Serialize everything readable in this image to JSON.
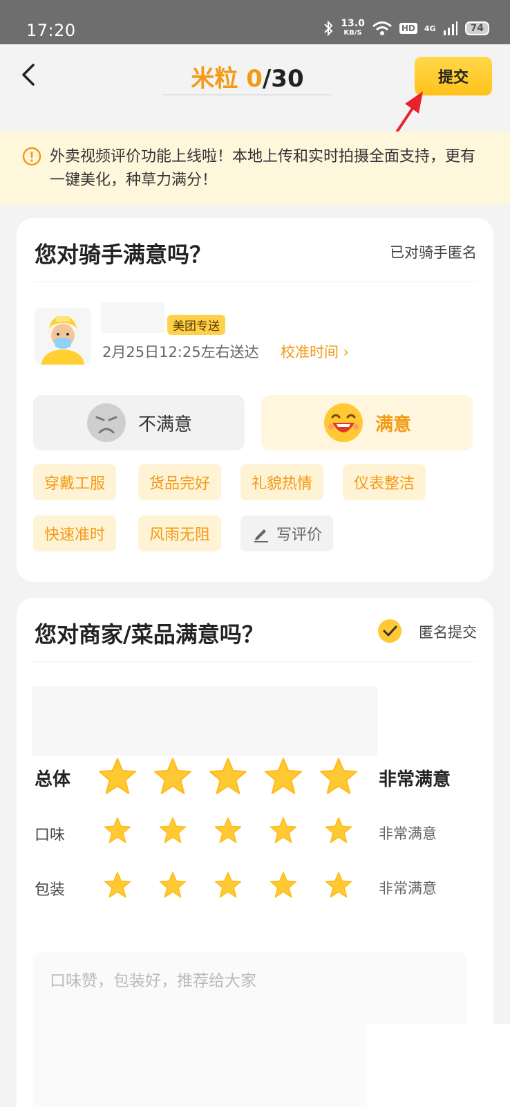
{
  "status_bar": {
    "time": "17:20",
    "net_speed": "13.0",
    "net_unit": "KB/S",
    "hd_badge": "HD",
    "signal_label": "4G",
    "battery": "74"
  },
  "header": {
    "title_label": "米粒",
    "title_current": "0",
    "title_total": "/30",
    "submit_label": "提交",
    "accent_color": "#f39a15"
  },
  "notice": {
    "text": "外卖视频评价功能上线啦！本地上传和实时拍摄全面支持，更有一键美化，种草力满分！"
  },
  "rider_card": {
    "title": "您对骑手满意吗？",
    "anonymous_label": "已对骑手匿名",
    "brand_tag": "美团专送",
    "delivery_time": "2月25日12:25左右送达",
    "calibrate_label": "校准时间 ›",
    "unsatisfied_label": "不满意",
    "satisfied_label": "满意",
    "tags": [
      "穿戴工服",
      "货品完好",
      "礼貌热情",
      "仪表整洁",
      "快速准时",
      "风雨无阻"
    ],
    "write_review_label": "写评价"
  },
  "merchant_card": {
    "title": "您对商家/菜品满意吗？",
    "anonymous_submit_label": "匿名提交",
    "ratings": [
      {
        "label": "总体",
        "stars": 5,
        "value": "非常满意"
      },
      {
        "label": "口味",
        "stars": 5,
        "value": "非常满意"
      },
      {
        "label": "包装",
        "stars": 5,
        "value": "非常满意"
      }
    ],
    "review_placeholder": "口味赞，包装好，推荐给大家"
  }
}
